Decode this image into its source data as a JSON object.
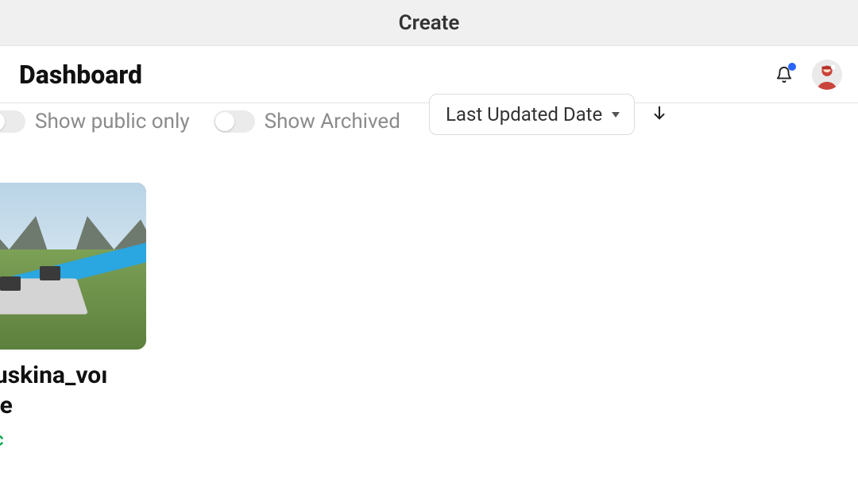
{
  "topTab": {
    "label": "Create"
  },
  "header": {
    "title": "Dashboard",
    "hasNotification": true
  },
  "filters": {
    "showPublicOnly": {
      "label": "Show public only",
      "on": false
    },
    "showArchived": {
      "label": "Show Archived",
      "on": false
    }
  },
  "sort": {
    "selected": "Last Updated Date",
    "direction": "desc"
  },
  "experiences": [
    {
      "title": "abuskina_vo(lace",
      "title_line1": "abuskina_voı",
      "title_line2": "lace",
      "status": "ıblic",
      "status_full": "Public"
    }
  ],
  "colors": {
    "statusPublic": "#0aa84f",
    "notificationDot": "#2864ff"
  }
}
